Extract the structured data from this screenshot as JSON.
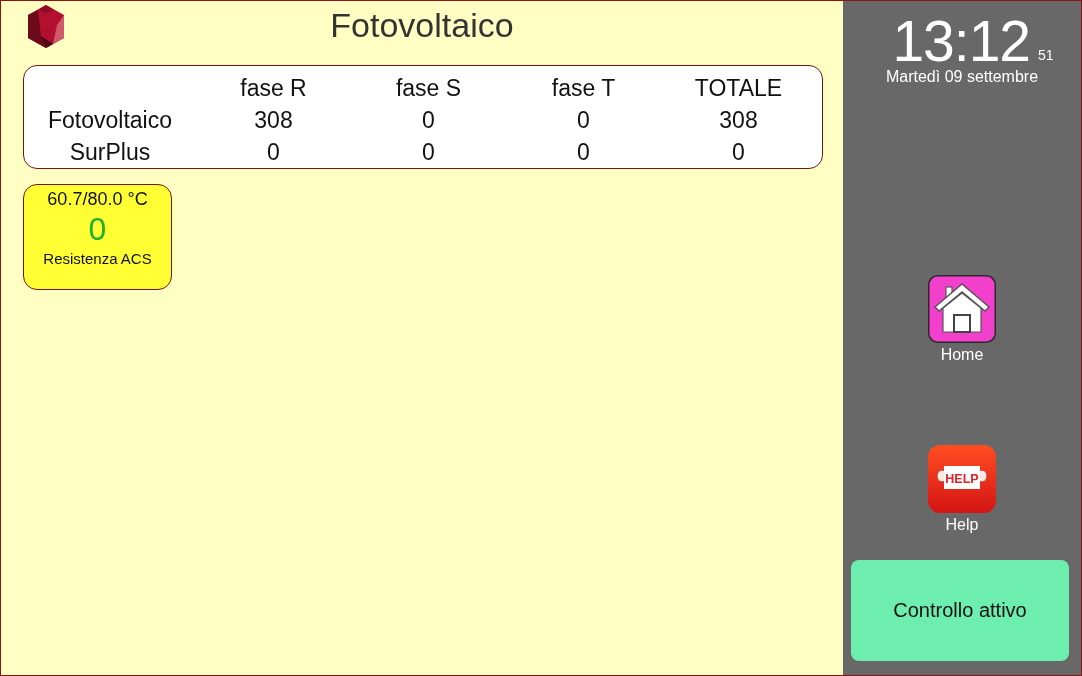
{
  "header": {
    "title": "Fotovoltaico"
  },
  "power_table": {
    "columns": [
      "fase R",
      "fase S",
      "fase T",
      "TOTALE"
    ],
    "rows": [
      {
        "label": "Fotovoltaico",
        "values": [
          "308",
          "0",
          "0",
          "308"
        ]
      },
      {
        "label": "SurPlus",
        "values": [
          "0",
          "0",
          "0",
          "0"
        ]
      }
    ]
  },
  "devices": [
    {
      "temperature": "60.7/80.0 °C",
      "value": "0",
      "name": "Resistenza ACS"
    }
  ],
  "clock": {
    "time": "13:12",
    "seconds": "51",
    "date": "Martedì 09 settembre"
  },
  "nav": [
    {
      "kind": "home",
      "label": "Home"
    },
    {
      "kind": "help",
      "label": "Help",
      "sign": "HELP"
    }
  ],
  "control_button": {
    "label": "Controllo attivo"
  }
}
